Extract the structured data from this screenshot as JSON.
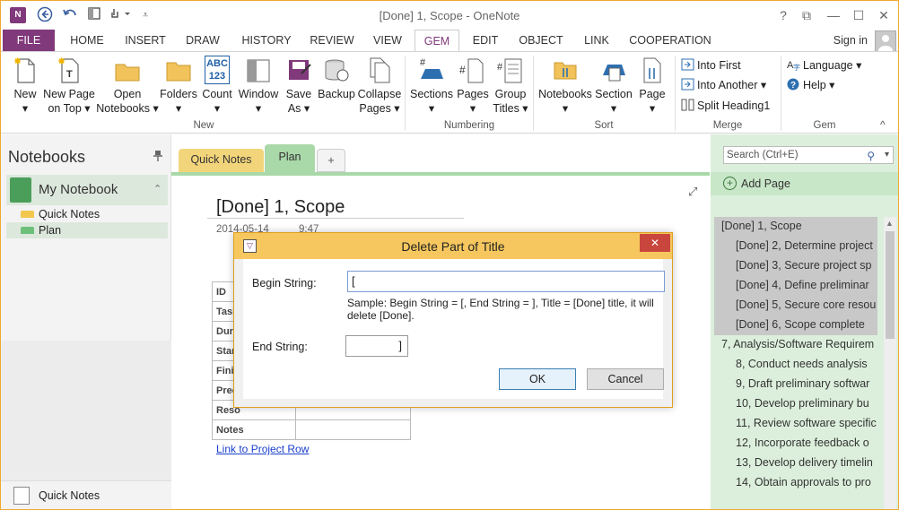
{
  "window": {
    "title": "[Done] 1, Scope - OneNote",
    "app_icon": "N",
    "help": "?",
    "restore": "⧉",
    "minimize": "—",
    "maximize": "☐",
    "close": "✕"
  },
  "tabs": [
    "FILE",
    "HOME",
    "INSERT",
    "DRAW",
    "HISTORY",
    "REVIEW",
    "VIEW",
    "GEM",
    "EDIT",
    "OBJECT",
    "LINK",
    "COOPERATION"
  ],
  "signin": "Sign in",
  "ribbon": {
    "new": {
      "label1": "New",
      "label2": "▾",
      "group": "New"
    },
    "new_page": {
      "label1": "New Page",
      "label2": "on Top ▾"
    },
    "open_notebooks": {
      "label1": "Open",
      "label2": "Notebooks ▾"
    },
    "folders": {
      "label1": "Folders",
      "label2": "▾"
    },
    "count": {
      "label1": "Count",
      "label2": "▾",
      "icon_text": "ABC 123"
    },
    "window": {
      "label1": "Window",
      "label2": "▾"
    },
    "save_as": {
      "label1": "Save",
      "label2": "As ▾"
    },
    "backup": {
      "label1": "Backup",
      "label2": ""
    },
    "collapse_pages": {
      "label1": "Collapse",
      "label2": "Pages ▾"
    },
    "sections": {
      "label1": "Sections",
      "label2": "▾"
    },
    "pages": {
      "label1": "Pages",
      "label2": "▾"
    },
    "group_titles": {
      "label1": "Group",
      "label2": "Titles ▾"
    },
    "numbering_group": "Numbering",
    "notebooks": {
      "label1": "Notebooks",
      "label2": "▾"
    },
    "section": {
      "label1": "Section",
      "label2": "▾"
    },
    "page": {
      "label1": "Page",
      "label2": "▾"
    },
    "sort_group": "Sort",
    "into_first": "Into First",
    "into_another": "Into Another ▾",
    "split_heading": "Split Heading1",
    "merge_group": "Merge",
    "language": "Language ▾",
    "help": "Help ▾",
    "gem_group": "Gem",
    "collapse_ribbon": "^"
  },
  "left_panel": {
    "title": "Notebooks",
    "notebook": "My Notebook",
    "sections": [
      {
        "label": "Quick Notes",
        "color": "#f2c74e"
      },
      {
        "label": "Plan",
        "color": "#6cc07a"
      }
    ],
    "bottom": "Quick Notes"
  },
  "section_tabs": {
    "quick_notes": "Quick Notes",
    "plan": "Plan",
    "add": "+"
  },
  "page": {
    "title": "[Done] 1, Scope",
    "date": "2014-05-14",
    "time": "9:47",
    "table_rows": [
      "ID",
      "Task",
      "Dur",
      "Star",
      "Finis",
      "Prec",
      "Reso",
      "Notes"
    ],
    "link": "Link to Project Row"
  },
  "right_panel": {
    "search_placeholder": "Search (Ctrl+E)",
    "add_page": "Add Page",
    "pages": [
      {
        "label": "[Done] 1, Scope",
        "indent": 0,
        "sel": true
      },
      {
        "label": "[Done] 2, Determine project",
        "indent": 1,
        "sel": true
      },
      {
        "label": "[Done] 3, Secure project sp",
        "indent": 1,
        "sel": true
      },
      {
        "label": "[Done] 4, Define preliminar",
        "indent": 1,
        "sel": true
      },
      {
        "label": "[Done] 5, Secure core resou",
        "indent": 1,
        "sel": true
      },
      {
        "label": "[Done] 6, Scope complete",
        "indent": 1,
        "sel": true
      },
      {
        "label": "7, Analysis/Software Requirem",
        "indent": 0,
        "sel": false
      },
      {
        "label": "8, Conduct needs analysis",
        "indent": 1,
        "sel": false
      },
      {
        "label": "9, Draft preliminary softwar",
        "indent": 1,
        "sel": false
      },
      {
        "label": "10, Develop preliminary bu",
        "indent": 1,
        "sel": false
      },
      {
        "label": "11, Review software specific",
        "indent": 1,
        "sel": false
      },
      {
        "label": "12, Incorporate feedback o",
        "indent": 1,
        "sel": false
      },
      {
        "label": "13, Develop delivery timelin",
        "indent": 1,
        "sel": false
      },
      {
        "label": "14, Obtain approvals to pro",
        "indent": 1,
        "sel": false
      }
    ]
  },
  "dialog": {
    "title": "Delete Part of Title",
    "begin_label": "Begin String:",
    "begin_value": "[",
    "sample": "Sample: Begin String = [, End String = ], Title = [Done] title, it will delete [Done].",
    "end_label": "End String:",
    "end_value": "]",
    "ok": "OK",
    "cancel": "Cancel",
    "close": "✕"
  }
}
